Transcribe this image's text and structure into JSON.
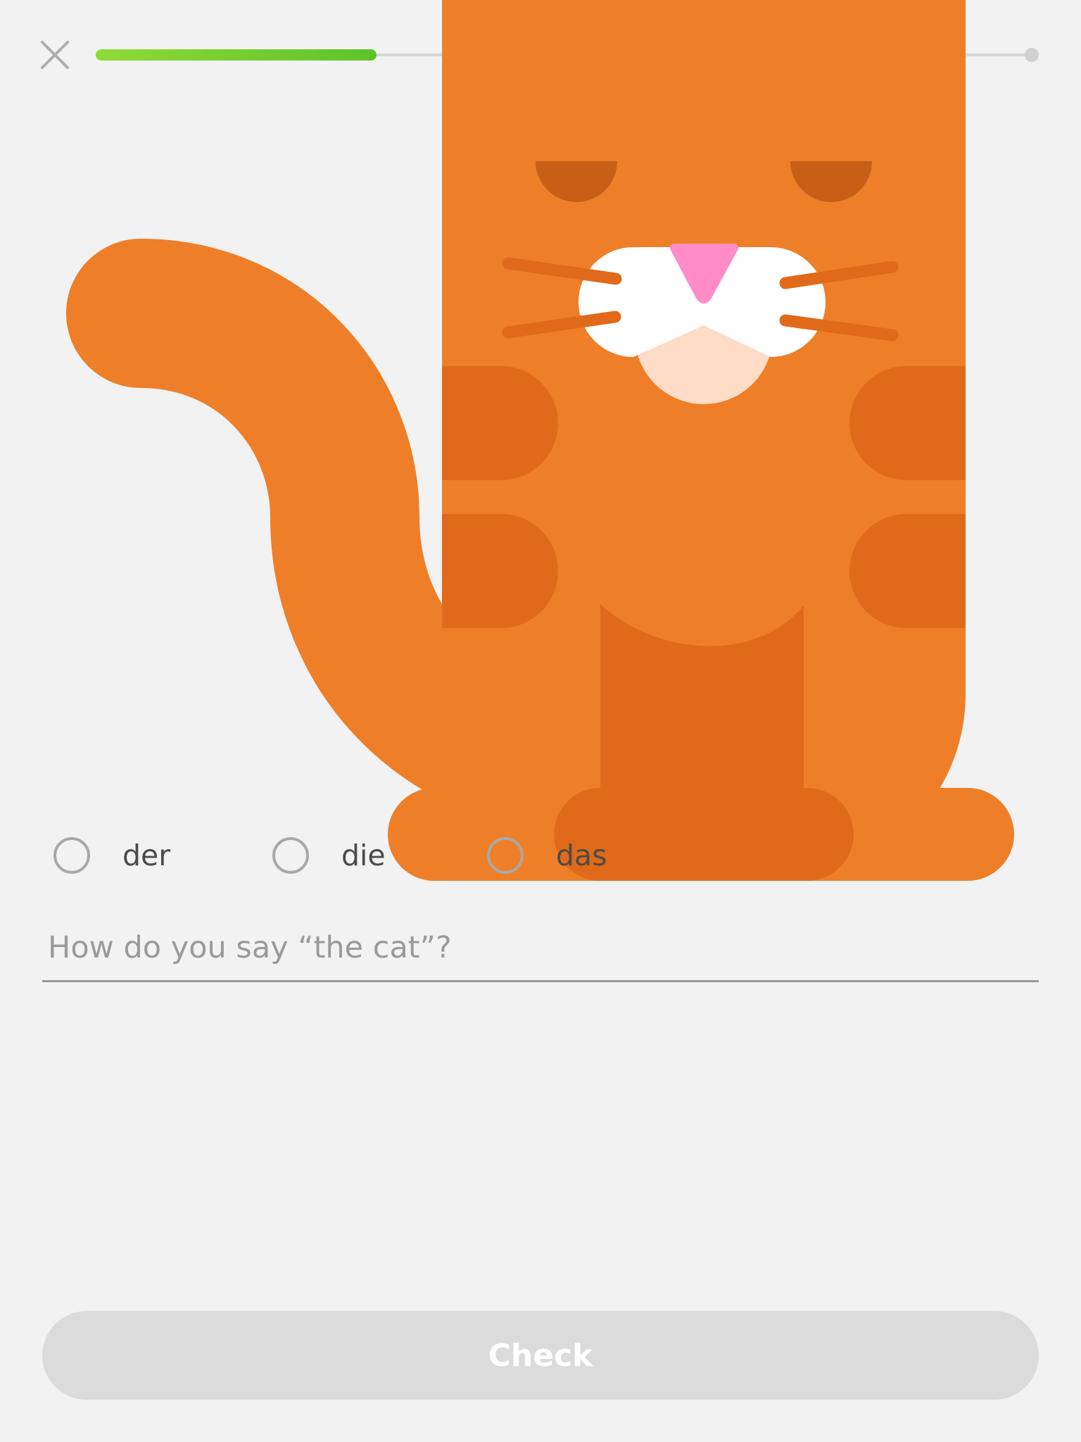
{
  "header": {
    "close_icon": "close-icon",
    "progress_fraction": 0.3
  },
  "illustration": {
    "subject": "cat",
    "colors": {
      "body": "#ee7f28",
      "spots": "#e06a19",
      "eyes": "#c85f17",
      "muzzle": "#ffffff",
      "mouth": "#ffdcc5",
      "nose": "#ff8cc6"
    }
  },
  "options": [
    {
      "label": "der"
    },
    {
      "label": "die"
    },
    {
      "label": "das"
    }
  ],
  "question": {
    "placeholder": "How do you say “the cat”?"
  },
  "footer": {
    "check_label": "Check"
  },
  "theme": {
    "background": "#f2f2f2",
    "progress_start": "#8fdb36",
    "progress_end": "#5fc22b",
    "button_disabled": "#dbdbdb",
    "button_text": "#ffffff"
  }
}
